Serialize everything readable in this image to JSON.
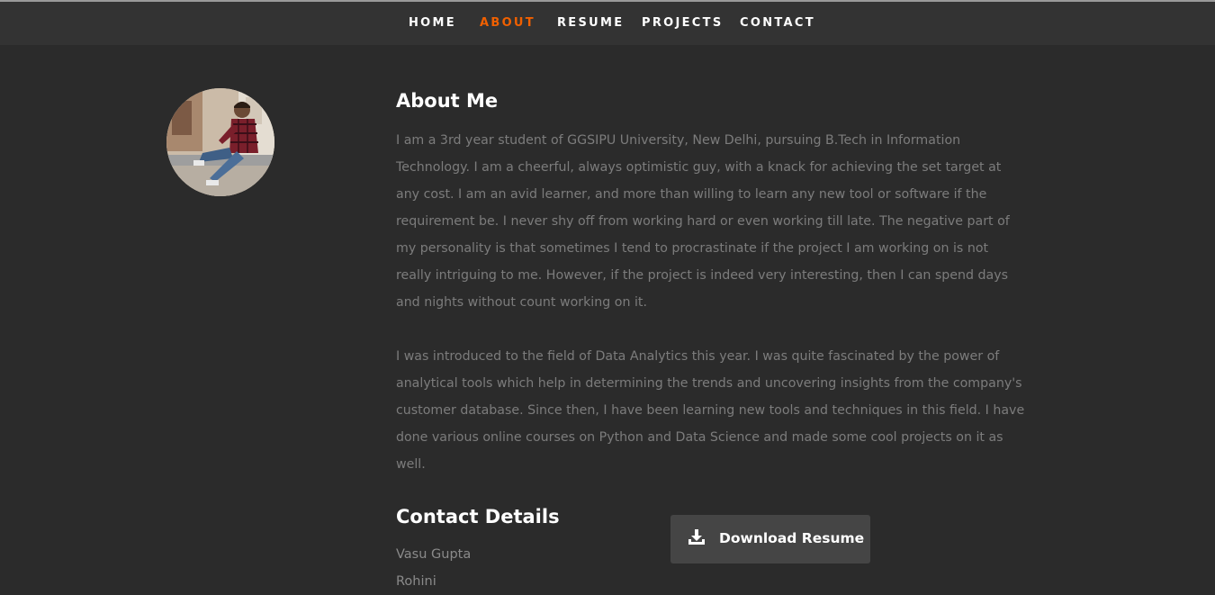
{
  "nav": {
    "items": [
      {
        "label": "HOME",
        "active": false
      },
      {
        "label": "ABOUT",
        "active": true
      },
      {
        "label": "RESUME",
        "active": false
      },
      {
        "label": "PROJECTS",
        "active": false
      },
      {
        "label": "CONTACT",
        "active": false
      }
    ],
    "active_color": "#f06000"
  },
  "about": {
    "title": "About Me",
    "paragraphs": [
      "I am a 3rd year student of GGSIPU University, New Delhi, pursuing B.Tech in Information Technology. I am a cheerful, always optimistic guy, with a knack for achieving the set target at any cost. I am an avid learner, and more than willing to learn any new tool or software if the requirement be. I never shy off from working hard or even working till late. The negative part of my personality is that sometimes I tend to procrastinate if the project I am working on is not really intriguing to me. However, if the project is indeed very interesting, then I can spend days and nights without count working on it.",
      "I was introduced to the field of Data Analytics this year. I was quite fascinated by the power of analytical tools which help in determining the trends and uncovering insights from the company's customer database. Since then, I have been learning new tools and techniques in this field. I have done various online courses on Python and Data Science and made some cool projects on it as well."
    ]
  },
  "contact": {
    "title": "Contact Details",
    "name": "Vasu Gupta",
    "location": "Rohini"
  },
  "download_button": {
    "label": "Download Resume",
    "icon": "download-icon"
  },
  "avatar": {
    "icon": "profile-photo"
  }
}
